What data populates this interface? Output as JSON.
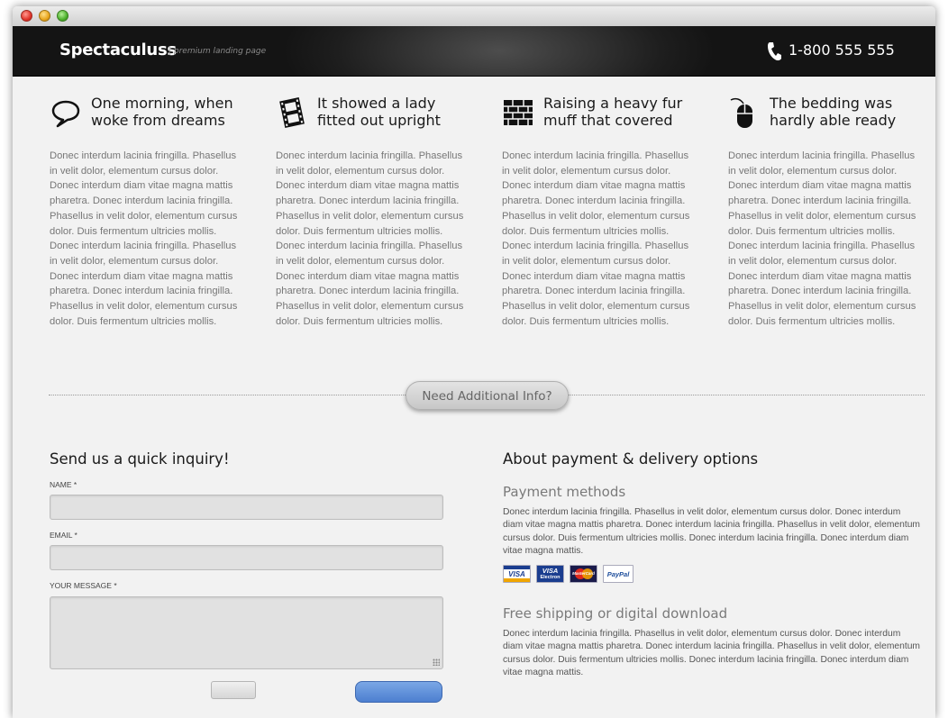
{
  "header": {
    "brand": "Spectaculuss",
    "tagline": "| premium landing page",
    "phone": "1-800 555 555"
  },
  "features": [
    {
      "icon": "speech-bubble-icon",
      "title": "One morning, when woke from dreams",
      "text": "Donec interdum lacinia fringilla. Phasellus in velit dolor, elementum cursus dolor. Donec interdum diam vitae magna mattis pharetra. Donec interdum lacinia fringilla. Phasellus in velit dolor, elementum cursus dolor. Duis fermentum ultricies mollis. Donec interdum lacinia fringilla. Phasellus in velit dolor, elementum cursus dolor. Donec interdum diam vitae magna mattis pharetra. Donec interdum lacinia fringilla. Phasellus in velit dolor, elementum cursus dolor. Duis fermentum ultricies mollis."
    },
    {
      "icon": "film-strip-icon",
      "title": "It showed a lady fitted out upright",
      "text": "Donec interdum lacinia fringilla. Phasellus in velit dolor, elementum cursus dolor. Donec interdum diam vitae magna mattis pharetra. Donec interdum lacinia fringilla. Phasellus in velit dolor, elementum cursus dolor. Duis fermentum ultricies mollis. Donec interdum lacinia fringilla. Phasellus in velit dolor, elementum cursus dolor. Donec interdum diam vitae magna mattis pharetra. Donec interdum lacinia fringilla. Phasellus in velit dolor, elementum cursus dolor. Duis fermentum ultricies mollis."
    },
    {
      "icon": "brick-wall-icon",
      "title": "Raising a heavy fur muff that covered",
      "text": "Donec interdum lacinia fringilla. Phasellus in velit dolor, elementum cursus dolor. Donec interdum diam vitae magna mattis pharetra. Donec interdum lacinia fringilla. Phasellus in velit dolor, elementum cursus dolor. Duis fermentum ultricies mollis. Donec interdum lacinia fringilla. Phasellus in velit dolor, elementum cursus dolor. Donec interdum diam vitae magna mattis pharetra. Donec interdum lacinia fringilla. Phasellus in velit dolor, elementum cursus dolor. Duis fermentum ultricies mollis."
    },
    {
      "icon": "mouse-icon",
      "title": "The bedding was hardly able ready",
      "text": "Donec interdum lacinia fringilla. Phasellus in velit dolor, elementum cursus dolor. Donec interdum diam vitae magna mattis pharetra. Donec interdum lacinia fringilla. Phasellus in velit dolor, elementum cursus dolor. Duis fermentum ultricies mollis. Donec interdum lacinia fringilla. Phasellus in velit dolor, elementum cursus dolor. Donec interdum diam vitae magna mattis pharetra. Donec interdum lacinia fringilla. Phasellus in velit dolor, elementum cursus dolor. Duis fermentum ultricies mollis."
    }
  ],
  "info_button": "Need Additional Info?",
  "form": {
    "title": "Send us a quick inquiry!",
    "name_label": "NAME *",
    "name_value": "",
    "email_label": "EMAIL *",
    "email_value": "",
    "message_label": "YOUR MESSAGE *",
    "message_value": ""
  },
  "about": {
    "title": "About payment & delivery options",
    "payment_title": "Payment methods",
    "payment_text": "Donec interdum lacinia fringilla. Phasellus in velit dolor, elementum cursus dolor. Donec interdum diam vitae magna mattis pharetra. Donec interdum lacinia fringilla. Phasellus in velit dolor, elementum cursus dolor. Duis fermentum ultricies mollis. Donec interdum lacinia fringilla. Donec interdum diam vitae magna mattis.",
    "cards": {
      "visa": "VISA",
      "electron_top": "VISA",
      "electron_bottom": "Electron",
      "mastercard": "MasterCard",
      "paypal": "PayPal"
    },
    "shipping_title": "Free shipping or digital download",
    "shipping_text": "Donec interdum lacinia fringilla. Phasellus in velit dolor, elementum cursus dolor. Donec interdum diam vitae magna mattis pharetra. Donec interdum lacinia fringilla. Phasellus in velit dolor, elementum cursus dolor. Duis fermentum ultricies mollis. Donec interdum lacinia fringilla. Donec interdum diam vitae magna mattis."
  }
}
